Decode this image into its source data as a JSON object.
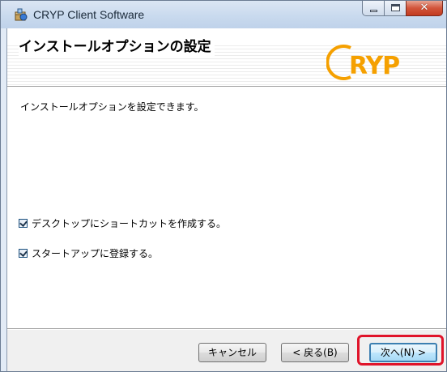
{
  "window": {
    "title": "CRYP Client Software",
    "icon": "installer-package-icon"
  },
  "banner": {
    "title": "インストールオプションの設定",
    "logo_text": "CRYP",
    "logo_color": "#f5a000"
  },
  "main": {
    "description": "インストールオプションを設定できます。",
    "options": [
      {
        "label": "デスクトップにショートカットを作成する。",
        "checked": true
      },
      {
        "label": "スタートアップに登録する。",
        "checked": true
      }
    ]
  },
  "footer": {
    "cancel_label": "キャンセル",
    "back_label": "< 戻る(B)",
    "next_label": "次へ(N) >",
    "highlight_color": "#e0142a"
  }
}
